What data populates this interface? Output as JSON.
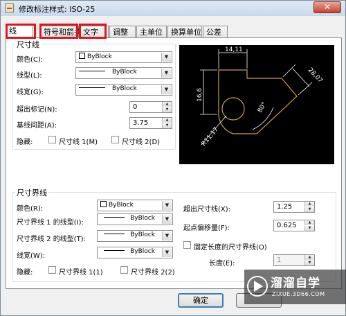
{
  "window": {
    "title": "修改标注样式: ISO-25",
    "close_symbol": "✕"
  },
  "tabs": [
    {
      "label": "线",
      "active": true
    },
    {
      "label": "符号和箭头"
    },
    {
      "label": "文字"
    },
    {
      "label": "调整"
    },
    {
      "label": "主单位"
    },
    {
      "label": "换算单位"
    },
    {
      "label": "公差"
    }
  ],
  "dim_lines": {
    "title": "尺寸线",
    "color": {
      "label": "颜色(C):",
      "value": "ByBlock"
    },
    "linetype": {
      "label": "线型(L):",
      "value": "ByBlock"
    },
    "lineweight": {
      "label": "线宽(G):",
      "value": "ByBlock"
    },
    "extend_beyond_ticks": {
      "label": "超出标记(N):",
      "value": "0"
    },
    "baseline_spacing": {
      "label": "基线间距(A):",
      "value": "3.75"
    },
    "suppress": {
      "label": "隐藏:",
      "line1": "尺寸线 1(M)",
      "line2": "尺寸线 2(D)"
    }
  },
  "preview": {
    "dim_top": "14,11",
    "dim_left": "16,6",
    "dim_right": "28,07",
    "angle": "80°",
    "radius": "R11,17",
    "colors": {
      "geometry": "#c8a23c",
      "dimension": "#ffffff",
      "background": "#000000"
    }
  },
  "ext_lines": {
    "title": "尺寸界线",
    "color": {
      "label": "颜色(R):",
      "value": "ByBlock"
    },
    "linetype1": {
      "label": "尺寸界线 1 的线型(I):",
      "value": "ByBlock"
    },
    "linetype2": {
      "label": "尺寸界线 2 的线型(T):",
      "value": "ByBlock"
    },
    "lineweight": {
      "label": "线宽(W):",
      "value": "ByBlock"
    },
    "suppress": {
      "label": "隐藏:",
      "line1": "尺寸界线 1(1)",
      "line2": "尺寸界线 2(2)"
    },
    "extend_beyond_dim": {
      "label": "超出尺寸线(X):",
      "value": "1.25"
    },
    "offset_from_origin": {
      "label": "起点偏移量(F):",
      "value": "0.625"
    },
    "fixed_length": {
      "label": "固定长度的尺寸界线(O)",
      "checked": false
    },
    "length": {
      "label": "长度(E):",
      "value": "1"
    }
  },
  "buttons": {
    "ok": "确定"
  },
  "watermark": {
    "brand": "溜溜自学",
    "url": "ZIXUE.3D66.COM"
  },
  "highlight_color": "#e0141e"
}
